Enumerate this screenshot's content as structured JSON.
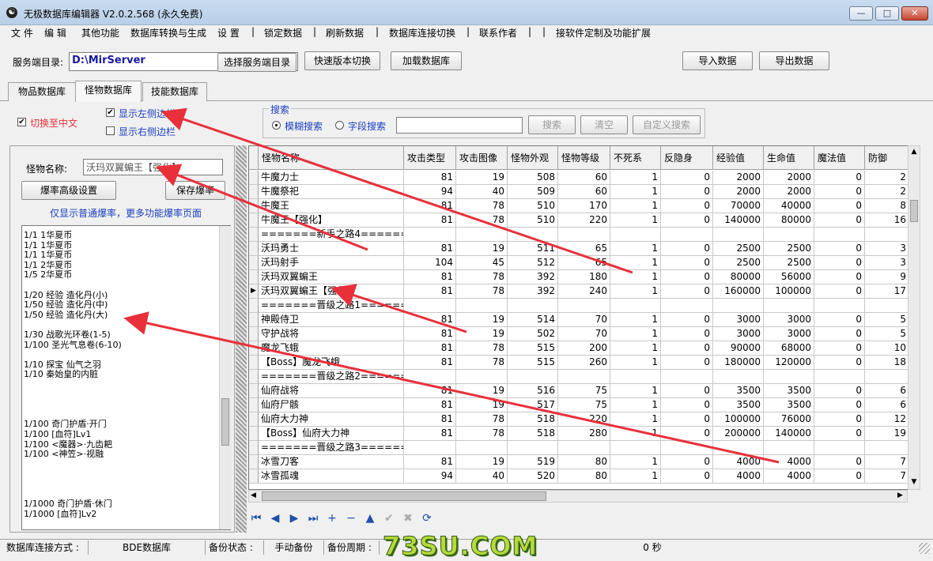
{
  "window": {
    "title": "无极数据库编辑器 V2.0.2.568 (永久免费)",
    "minimize": "—",
    "maximize": "□",
    "close": "✕"
  },
  "menu": [
    "文 件",
    "编 辑",
    "其他功能",
    "数据库转换与生成",
    "设 置",
    "|",
    "锁定数据",
    "|",
    "刷新数据",
    "|",
    "数据库连接切换",
    "|",
    "联系作者",
    "|",
    "|",
    "接软件定制及功能扩展"
  ],
  "toolbar": {
    "server_label": "服务端目录:",
    "server_path": "D:\\MirServer",
    "choose_dir": "选择服务端目录",
    "quick_switch": "快速版本切换",
    "load_db": "加载数据库",
    "import": "导入数据",
    "export": "导出数据"
  },
  "tabs": [
    "物品数据库",
    "怪物数据库",
    "技能数据库"
  ],
  "active_tab": 1,
  "options": {
    "switch_cn": "切换至中文",
    "show_left": "显示左侧边栏",
    "show_right": "显示右侧边栏",
    "search_group": "搜索",
    "fuzzy": "模糊搜索",
    "field": "字段搜索",
    "search_value": "",
    "search_btn": "搜索",
    "clear_btn": "清空",
    "custom_btn": "自定义搜索"
  },
  "left": {
    "monster_name_label": "怪物名称:",
    "monster_name": "沃玛双翼蝙王【强化】",
    "advanced_btn": "爆率高级设置",
    "save_btn": "保存爆率",
    "hint": "仅显示普通爆率，更多功能爆率页面",
    "drops": [
      "1/1 1华夏币",
      "1/1 1华夏币",
      "1/1 1华夏币",
      "1/1 2华夏币",
      "1/5 2华夏币",
      "",
      "1/20 经验 造化丹(小)",
      "1/50 经验 造化丹(中)",
      "1/50 经验 造化丹(大)",
      "",
      "1/30 战歌光环卷(1-5)",
      "1/100 圣光气息卷(6-10)",
      "",
      "1/10 探宝 仙气之羽",
      "1/10 秦始皇的内脏",
      "",
      "",
      "",
      "",
      "1/100 奇门护盾·开门",
      "1/100 [血符]Lv1",
      "1/100 <魔器>·九齿耙",
      "1/100 <神笠>·视融",
      "",
      "",
      "",
      "",
      "1/1000 奇门护盾·休门",
      "1/1000 [血符]Lv2"
    ]
  },
  "grid": {
    "columns": [
      "怪物名称",
      "攻击类型",
      "攻击图像",
      "怪物外观",
      "怪物等级",
      "不死系",
      "反隐身",
      "经验值",
      "生命值",
      "魔法值",
      "防御"
    ],
    "rows": [
      [
        "牛魔力士",
        "81",
        "19",
        "508",
        "60",
        "1",
        "0",
        "2000",
        "2000",
        "0",
        "2"
      ],
      [
        "牛魔祭祀",
        "94",
        "40",
        "509",
        "60",
        "1",
        "0",
        "2000",
        "2000",
        "0",
        "2"
      ],
      [
        "牛魔王",
        "81",
        "78",
        "510",
        "170",
        "1",
        "0",
        "70000",
        "40000",
        "0",
        "8"
      ],
      [
        "牛魔王【强化】",
        "81",
        "78",
        "510",
        "220",
        "1",
        "0",
        "140000",
        "80000",
        "0",
        "16"
      ],
      [
        "=======新手之路4=========",
        "",
        "",
        "",
        "",
        "",
        "",
        "",
        "",
        "",
        ""
      ],
      [
        "沃玛勇士",
        "81",
        "19",
        "511",
        "65",
        "1",
        "0",
        "2500",
        "2500",
        "0",
        "3"
      ],
      [
        "沃玛射手",
        "104",
        "45",
        "512",
        "65",
        "1",
        "0",
        "2500",
        "2500",
        "0",
        "3"
      ],
      [
        "沃玛双翼蝙王",
        "81",
        "78",
        "392",
        "180",
        "1",
        "0",
        "80000",
        "56000",
        "0",
        "9"
      ],
      [
        "沃玛双翼蝙王【强化】",
        "81",
        "78",
        "392",
        "240",
        "1",
        "0",
        "160000",
        "100000",
        "0",
        "17"
      ],
      [
        "=======晋级之路1=========",
        "",
        "",
        "",
        "",
        "",
        "",
        "",
        "",
        "",
        ""
      ],
      [
        "神殿侍卫",
        "81",
        "19",
        "514",
        "70",
        "1",
        "0",
        "3000",
        "3000",
        "0",
        "5"
      ],
      [
        "守护战将",
        "81",
        "19",
        "502",
        "70",
        "1",
        "0",
        "3000",
        "3000",
        "0",
        "5"
      ],
      [
        "魔龙飞蛾",
        "81",
        "78",
        "515",
        "200",
        "1",
        "0",
        "90000",
        "68000",
        "0",
        "10"
      ],
      [
        "【Boss】魔龙飞蛾",
        "81",
        "78",
        "515",
        "260",
        "1",
        "0",
        "180000",
        "120000",
        "0",
        "18"
      ],
      [
        "=======晋级之路2=========",
        "",
        "",
        "",
        "",
        "",
        "",
        "",
        "",
        "",
        ""
      ],
      [
        "仙府战将",
        "81",
        "19",
        "516",
        "75",
        "1",
        "0",
        "3500",
        "3500",
        "0",
        "6"
      ],
      [
        "仙府尸骸",
        "81",
        "19",
        "517",
        "75",
        "1",
        "0",
        "3500",
        "3500",
        "0",
        "6"
      ],
      [
        "仙府大力神",
        "81",
        "78",
        "518",
        "220",
        "1",
        "0",
        "100000",
        "76000",
        "0",
        "12"
      ],
      [
        "【Boss】仙府大力神",
        "81",
        "78",
        "518",
        "280",
        "1",
        "0",
        "200000",
        "140000",
        "0",
        "19"
      ],
      [
        "=======晋级之路3=========",
        "",
        "",
        "",
        "",
        "",
        "",
        "",
        "",
        "",
        ""
      ],
      [
        "冰雪刀客",
        "81",
        "19",
        "519",
        "80",
        "1",
        "0",
        "4000",
        "4000",
        "0",
        "7"
      ],
      [
        "冰雪孤魂",
        "94",
        "40",
        "520",
        "80",
        "1",
        "0",
        "4000",
        "4000",
        "0",
        "7"
      ]
    ],
    "selected_row": 8,
    "current_marker": "▶"
  },
  "navigator": [
    "⏮",
    "◀",
    "▶",
    "⏭",
    "+",
    "−",
    "▲",
    "✔",
    "✖",
    "⟳"
  ],
  "navigator_icons": [
    "first-icon",
    "prior-icon",
    "next-icon",
    "last-icon",
    "insert-icon",
    "delete-icon",
    "edit-icon",
    "post-icon",
    "cancel-icon",
    "refresh-icon"
  ],
  "status": {
    "conn_label": "数据库连接方式 :",
    "conn_value": "BDE数据库",
    "backup_label": "备份状态 :",
    "backup_value": "手动备份",
    "period_label": "备份周期 :",
    "seconds": "0 秒"
  },
  "watermark": "73SU.COM",
  "colors": {
    "accent_red": "#e8303a",
    "link_blue": "#1a3fbf",
    "title_grad": "#c9dbef"
  }
}
